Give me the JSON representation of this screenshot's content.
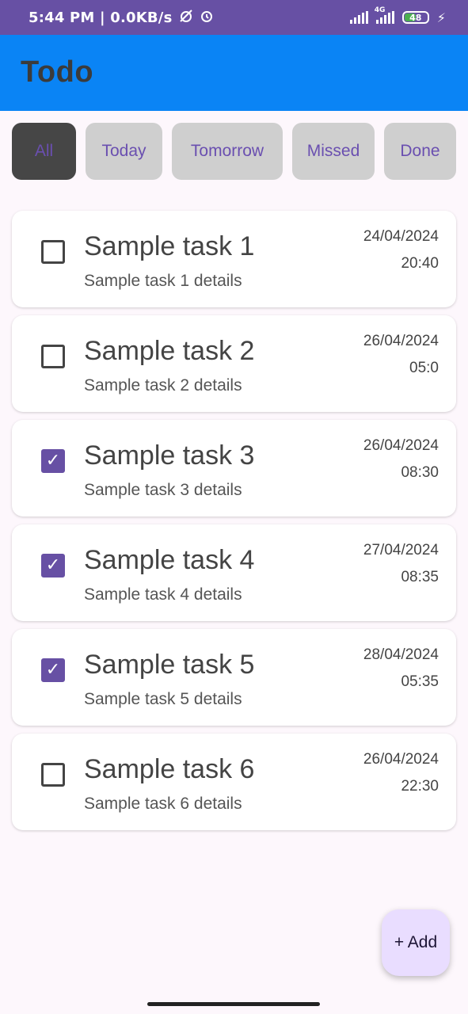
{
  "status_bar": {
    "time": "5:44 PM | 0.0KB/s",
    "network_label": "4G",
    "battery": "48",
    "icons": [
      "alarm-off-icon",
      "alarm-icon",
      "signal-icon",
      "4g-signal-icon",
      "battery-icon",
      "charging-bolt-icon"
    ]
  },
  "app_bar": {
    "title": "Todo",
    "color": "#0a84f5"
  },
  "filters": {
    "selected": "All",
    "items": [
      {
        "label": "All"
      },
      {
        "label": "Today"
      },
      {
        "label": "Tomorrow"
      },
      {
        "label": "Missed"
      },
      {
        "label": "Done"
      }
    ]
  },
  "tasks": [
    {
      "title": "Sample task 1",
      "details": "Sample task 1 details",
      "date": "24/04/2024",
      "time": "20:40",
      "done": false
    },
    {
      "title": "Sample task 2",
      "details": "Sample task 2 details",
      "date": "26/04/2024",
      "time": "05:0",
      "done": false
    },
    {
      "title": "Sample task 3",
      "details": "Sample task 3 details",
      "date": "26/04/2024",
      "time": "08:30",
      "done": true
    },
    {
      "title": "Sample task 4",
      "details": "Sample task 4 details",
      "date": "27/04/2024",
      "time": "08:35",
      "done": true
    },
    {
      "title": "Sample task 5",
      "details": "Sample task 5 details",
      "date": "28/04/2024",
      "time": "05:35",
      "done": true
    },
    {
      "title": "Sample task 6",
      "details": "Sample task 6 details",
      "date": "26/04/2024",
      "time": "22:30",
      "done": false
    }
  ],
  "fab": {
    "label": "+ Add"
  },
  "colors": {
    "accent": "#6750a4",
    "fab_bg": "#e9ddff",
    "background": "#fdf7fc"
  }
}
